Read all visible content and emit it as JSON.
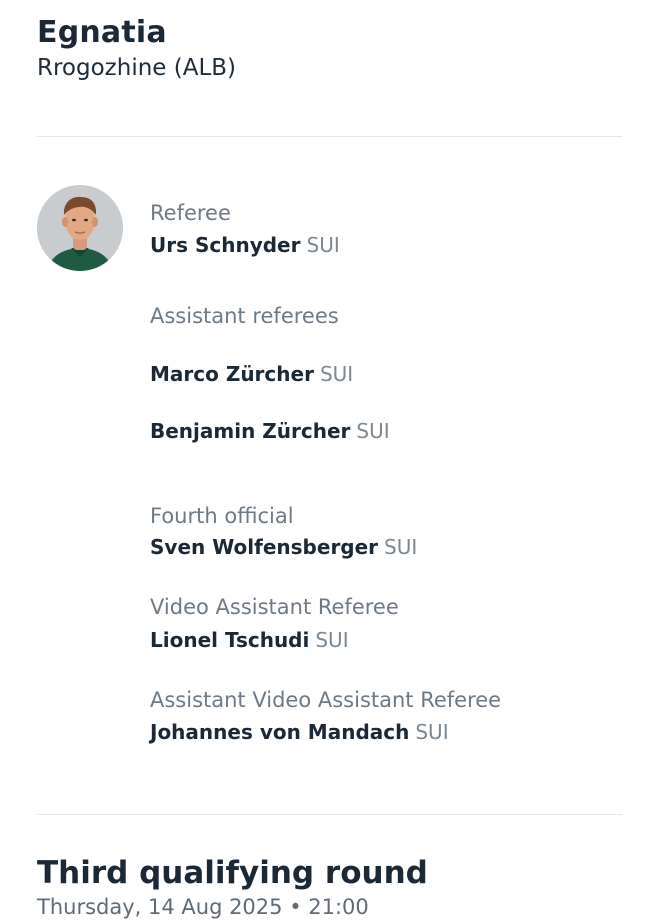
{
  "venue": {
    "name": "Egnatia",
    "city": "Rrogozhine (ALB)"
  },
  "referee": {
    "role": "Referee",
    "name": "Urs Schnyder",
    "nationality": "SUI"
  },
  "assistants": {
    "role": "Assistant referees",
    "list": [
      {
        "name": "Marco Zürcher",
        "nationality": "SUI"
      },
      {
        "name": "Benjamin Zürcher",
        "nationality": "SUI"
      }
    ]
  },
  "fourth_official": {
    "role": "Fourth official",
    "name": "Sven Wolfensberger",
    "nationality": "SUI"
  },
  "var": {
    "role": "Video Assistant Referee",
    "name": "Lionel Tschudi",
    "nationality": "SUI"
  },
  "avar": {
    "role": "Assistant Video Assistant Referee",
    "name": "Johannes von Mandach",
    "nationality": "SUI"
  },
  "round": {
    "title": "Third qualifying round",
    "date": "Thursday, 14 Aug 2025 • 21:00"
  }
}
